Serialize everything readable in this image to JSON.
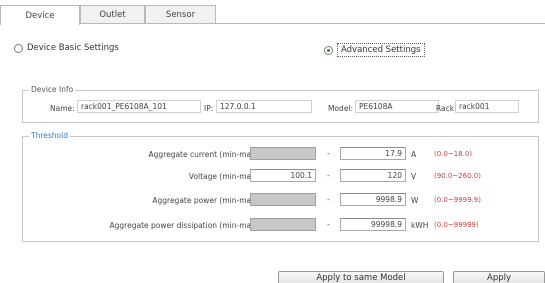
{
  "tabs": [
    {
      "label": "Device",
      "active": true
    },
    {
      "label": "Outlet",
      "active": false
    },
    {
      "label": "Sensor",
      "active": false
    }
  ],
  "mode": {
    "basic_label": "Device Basic Settings",
    "advanced_label": "Advanced Settings",
    "selected": "advanced"
  },
  "device_info": {
    "title": "Device Info",
    "name_label": "Name:",
    "name_value": "rack001_PE6108A_101",
    "ip_label": "IP:",
    "ip_value": "127.0.0.1",
    "model_label": "Model:",
    "model_value": "PE6108A",
    "rack_label": "Rack:",
    "rack_value": "rack001"
  },
  "threshold": {
    "title": "Threshold",
    "separator": "-",
    "rows": [
      {
        "label": "Aggregate current (min-max):",
        "min": "",
        "max": "17.9",
        "unit": "A",
        "range": "(0.0~18.0)"
      },
      {
        "label": "Voltage (min-max):",
        "min": "100.1",
        "max": "120",
        "unit": "V",
        "range": "(90.0~260.0)"
      },
      {
        "label": "Aggregate power (min-max):",
        "min": "",
        "max": "9998.9",
        "unit": "W",
        "range": "(0.0~9999.9)"
      },
      {
        "label": "Aggregate power dissipation (min-max):",
        "min": "",
        "max": "99998.9",
        "unit": "kWH",
        "range": "(0.0~99999)"
      }
    ]
  },
  "buttons": {
    "apply_same_model": "Apply to same Model",
    "apply": "Apply"
  },
  "colors": {
    "threshold_title": "#3a7ab8",
    "range_text": "#d23b3b",
    "disabled_field": "#c8c8c8"
  }
}
